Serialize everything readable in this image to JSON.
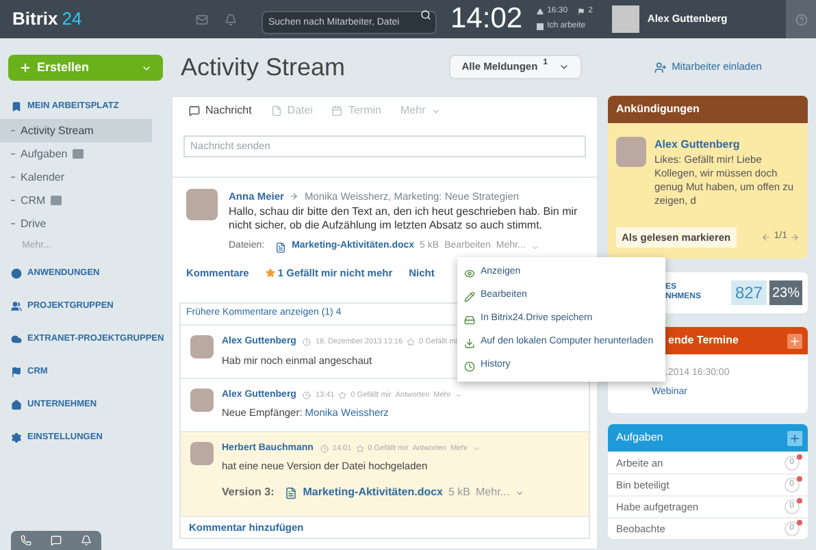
{
  "topbar": {
    "logo": "Bitrix",
    "logo_number": "24",
    "search": {
      "placeholder": "Suchen nach Mitarbeiter, Datei"
    },
    "clock": "14:02",
    "alarm": "16:30",
    "flags": "2",
    "work_status": "Ich arbeite",
    "user": "Alex Guttenberg"
  },
  "create_button": "Erstellen",
  "sidebar": {
    "sections": [
      {
        "label": "MEIN ARBEITSPLATZ",
        "items": [
          {
            "label": "Activity Stream",
            "selected": true,
            "badge": false
          },
          {
            "label": "Aufgaben",
            "selected": false,
            "badge": true
          },
          {
            "label": "Kalender",
            "selected": false,
            "badge": false
          },
          {
            "label": "CRM",
            "selected": false,
            "badge": true
          },
          {
            "label": "Drive",
            "selected": false,
            "badge": false
          }
        ],
        "more": "Mehr..."
      },
      {
        "label": "ANWENDUNGEN"
      },
      {
        "label": "PROJEKTGRUPPEN"
      },
      {
        "label": "EXTRANET-PROJEKTGRUPPEN"
      },
      {
        "label": "CRM"
      },
      {
        "label": "UNTERNEHMEN"
      },
      {
        "label": "EINSTELLUNGEN"
      }
    ]
  },
  "header": {
    "title": "Activity Stream",
    "filter": {
      "label": "Alle Meldungen",
      "count": "1"
    },
    "invite": "Mitarbeiter einladen"
  },
  "composer": {
    "tabs": [
      {
        "label": "Nachricht",
        "selected": true,
        "dropdown": false
      },
      {
        "label": "Datei",
        "selected": false,
        "dropdown": false
      },
      {
        "label": "Termin",
        "selected": false,
        "dropdown": false
      },
      {
        "label": "Mehr",
        "selected": false,
        "dropdown": true
      }
    ],
    "placeholder": "Nachricht senden"
  },
  "post": {
    "author": "Anna Meier",
    "recipients": "Monika Weissherz, Marketing: Neue Strategien",
    "text": "Hallo, schau dir bitte den Text an, den ich heut geschrieben hab. Bin mir nicht sicher, ob die Aufzählung im letzten Absatz so auch stimmt.",
    "files_label": "Dateien:",
    "file": {
      "name": "Marketing-Aktivitäten.docx",
      "size": "5 kB",
      "edit": "Bearbeiten",
      "more": "Mehr..."
    },
    "actions": [
      {
        "label": "Kommentare",
        "kind": "link"
      },
      {
        "label": "1 Gefällt mir nicht mehr",
        "kind": "like"
      },
      {
        "label": "Nicht",
        "kind": "link"
      }
    ]
  },
  "comments": {
    "earlier": "Frühere Kommentare anzeigen (1)",
    "earlier_count": "4",
    "items": [
      {
        "author": "Alex Guttenberg",
        "time": "18. Dezember 2013 13:16",
        "likes": "0 Gefällt mi",
        "text": "Hab mir noch einmal angeschaut",
        "highlighted": false
      },
      {
        "author": "Alex Guttenberg",
        "time": "13:41",
        "likes": "0 Gefällt mir",
        "reply": "Antworten",
        "more": "Mehr",
        "text": "Neue Empfänger:",
        "link": "Monika Weissherz",
        "highlighted": false
      },
      {
        "author": "Herbert Bauchmann",
        "time": "14:01",
        "likes": "0 Gefällt mir",
        "reply": "Antworten",
        "more": "Mehr",
        "text": "hat eine neue Version der Datei hochgeladen",
        "version": {
          "label": "Version 3:",
          "file": "Marketing-Aktivitäten.docx",
          "size": "5 kB",
          "more": "Mehr..."
        },
        "highlighted": true
      }
    ],
    "add": "Kommentar hinzufügen"
  },
  "menu": {
    "items": [
      {
        "label": "Anzeigen"
      },
      {
        "label": "Bearbeiten"
      },
      {
        "label": "In Bitrix24.Drive speichern"
      },
      {
        "label": "Auf den lokalen Computer herunterladen"
      },
      {
        "label": "History"
      }
    ]
  },
  "announcement": {
    "title": "Ankündigungen",
    "author": "Alex Guttenberg",
    "text": "Likes: Gefällt mir! Liebe Kollegen, wir müssen doch genug Mut haben, um offen zu zeigen, d",
    "button": "Als gelesen markieren",
    "pager": "1/1"
  },
  "stats": {
    "label_line1": "ES",
    "label_line2": "NHMENS",
    "value": "827",
    "percent": "23%"
  },
  "events": {
    "title": "ende Termine",
    "date": ".2014 16:30:00",
    "name": "Webinar"
  },
  "tasks": {
    "title": "Aufgaben",
    "rows": [
      {
        "label": "Arbeite an",
        "count": "0"
      },
      {
        "label": "Bin beteiligt",
        "count": "0"
      },
      {
        "label": "Habe aufgetragen",
        "count": "0"
      },
      {
        "label": "Beobachte",
        "count": "0"
      }
    ]
  }
}
